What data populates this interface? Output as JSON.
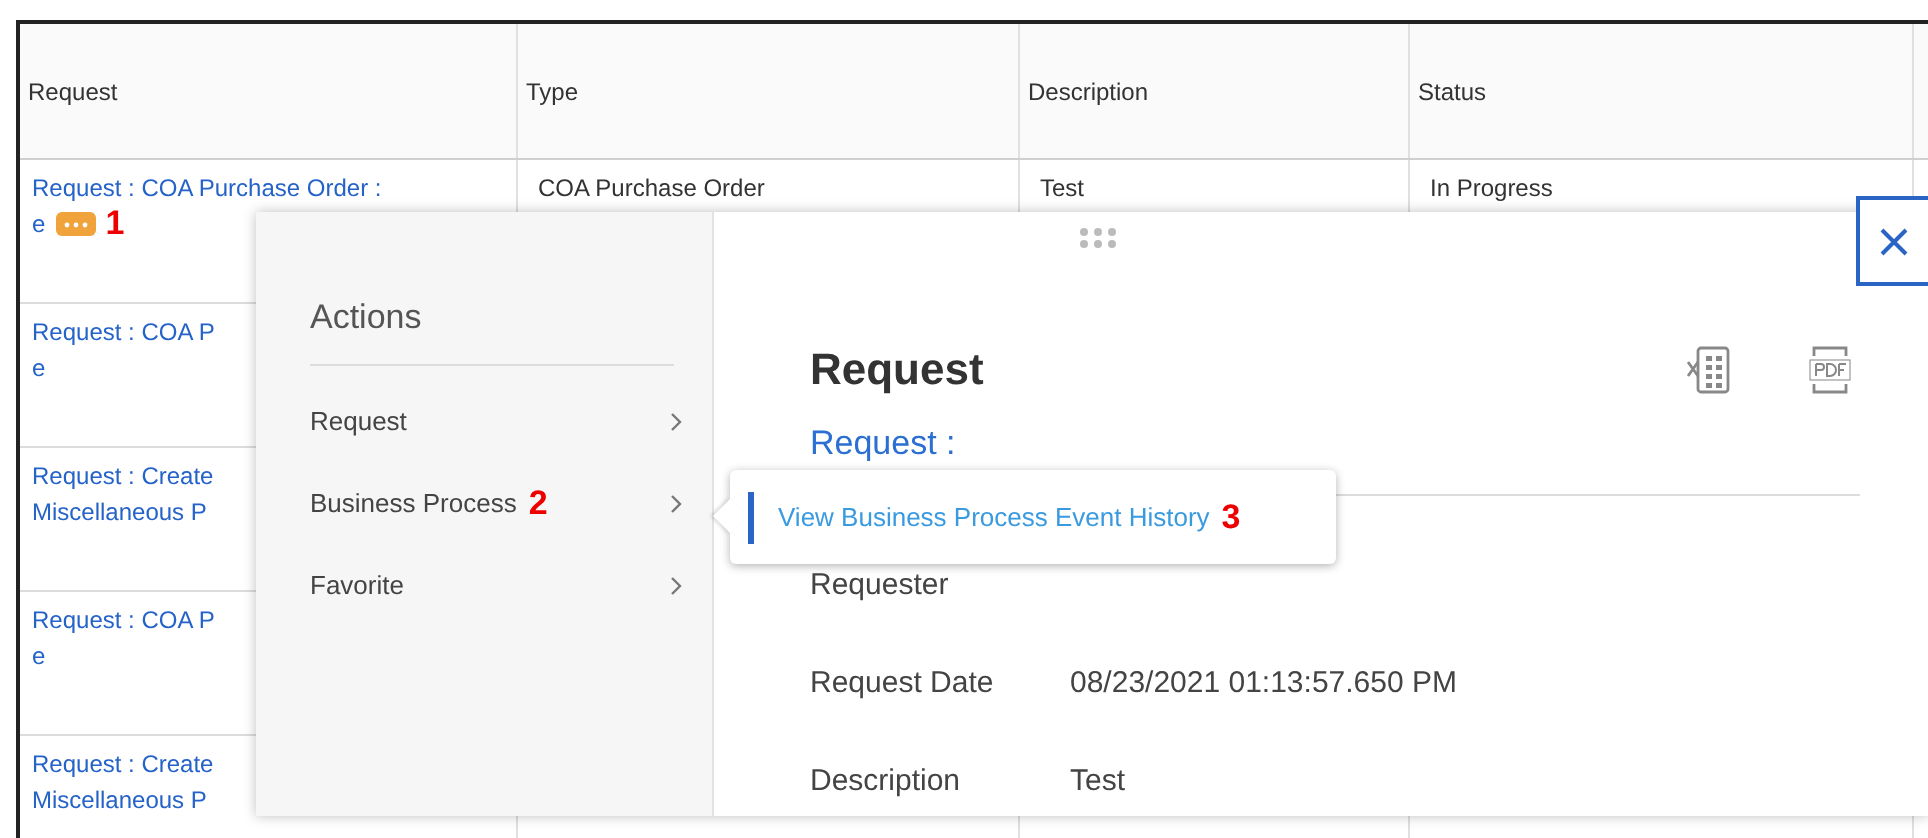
{
  "table": {
    "columns": [
      "Request",
      "Type",
      "Description",
      "Status"
    ],
    "rows": [
      {
        "request": [
          "Request : COA Purchase Order :",
          "e"
        ],
        "type": "COA Purchase Order",
        "description": "Test",
        "status": "In Progress",
        "has_actions": true,
        "annotation": "1"
      },
      {
        "request": [
          "Request : COA P",
          "e"
        ],
        "has_actions": false
      },
      {
        "request": [
          "Request : Create",
          "Miscellaneous P"
        ],
        "has_actions": false
      },
      {
        "request": [
          "Request : COA P",
          "e"
        ],
        "has_actions": false
      },
      {
        "request": [
          "Request : Create",
          "Miscellaneous P"
        ],
        "has_actions": false
      }
    ]
  },
  "actions_menu": {
    "title": "Actions",
    "items": [
      {
        "label": "Request"
      },
      {
        "label": "Business Process",
        "annotation": "2"
      },
      {
        "label": "Favorite"
      }
    ]
  },
  "submenu": {
    "items": [
      {
        "label": "View Business Process Event History",
        "annotation": "3"
      }
    ]
  },
  "details": {
    "title": "Request",
    "subtitle": "Request :",
    "fields": [
      {
        "label": "Requester"
      },
      {
        "label": "Request Date",
        "value": "08/23/2021 01:13:57.650 PM"
      },
      {
        "label": "Description",
        "value": "Test"
      }
    ]
  }
}
